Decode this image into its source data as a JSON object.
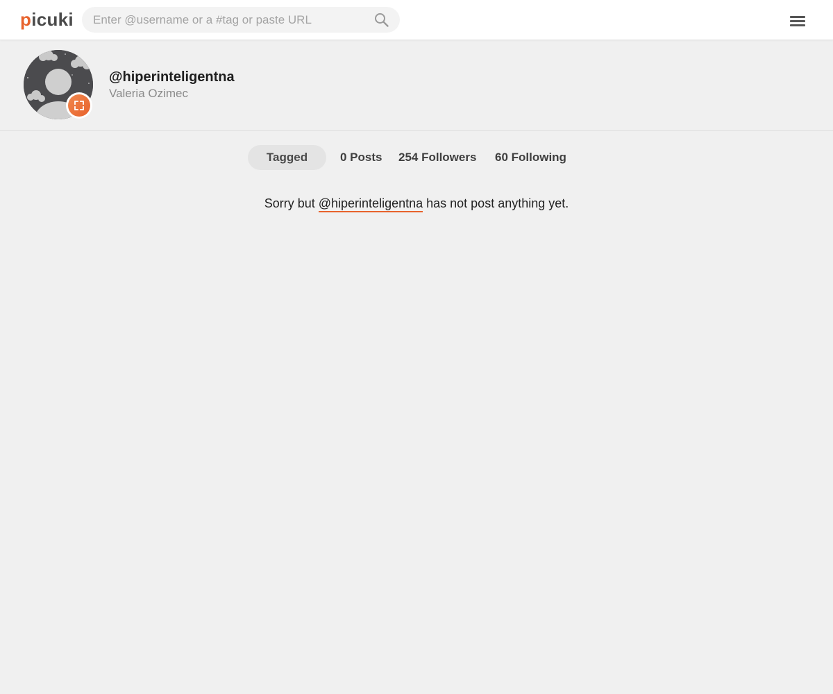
{
  "header": {
    "logo_first": "p",
    "logo_rest": "icuki",
    "search_placeholder": "Enter @username or a #tag or paste URL",
    "search_value": "",
    "search_icon": "search-icon",
    "menu_icon": "hamburger-menu-icon"
  },
  "profile": {
    "username": "@hiperinteligentna",
    "full_name": "Valeria Ozimec",
    "expand_icon": "expand-icon"
  },
  "tabs": {
    "tagged_label": "Tagged",
    "posts": "0 Posts",
    "followers": "254 Followers",
    "following": "60 Following"
  },
  "empty_state": {
    "prefix": "Sorry but ",
    "handle": "@hiperinteligentna",
    "suffix": " has not post anything yet."
  },
  "colors": {
    "accent": "#e8622c",
    "background": "#f0f0f0",
    "header_bg": "#ffffff"
  }
}
